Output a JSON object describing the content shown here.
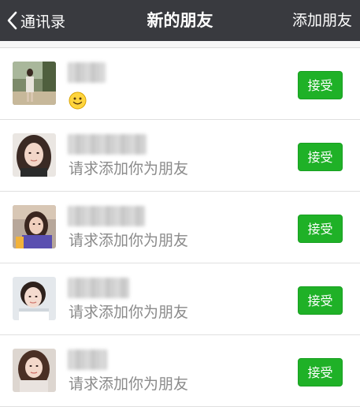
{
  "navbar": {
    "back_label": "通讯录",
    "back_icon": "chevron-left-icon",
    "title": "新的朋友",
    "action_label": "添加朋友"
  },
  "requests": [
    {
      "message": "",
      "has_emoji": true,
      "emoji": "smiling-face-emoji",
      "accept_label": "接受"
    },
    {
      "message": "请求添加你为朋友",
      "has_emoji": false,
      "accept_label": "接受"
    },
    {
      "message": "请求添加你为朋友",
      "has_emoji": false,
      "accept_label": "接受"
    },
    {
      "message": "请求添加你为朋友",
      "has_emoji": false,
      "accept_label": "接受"
    },
    {
      "message": "请求添加你为朋友",
      "has_emoji": false,
      "accept_label": "接受"
    }
  ],
  "colors": {
    "navbar_bg": "#393a3f",
    "accept_button": "#1fb127",
    "page_bg": "#f7f7f7"
  }
}
